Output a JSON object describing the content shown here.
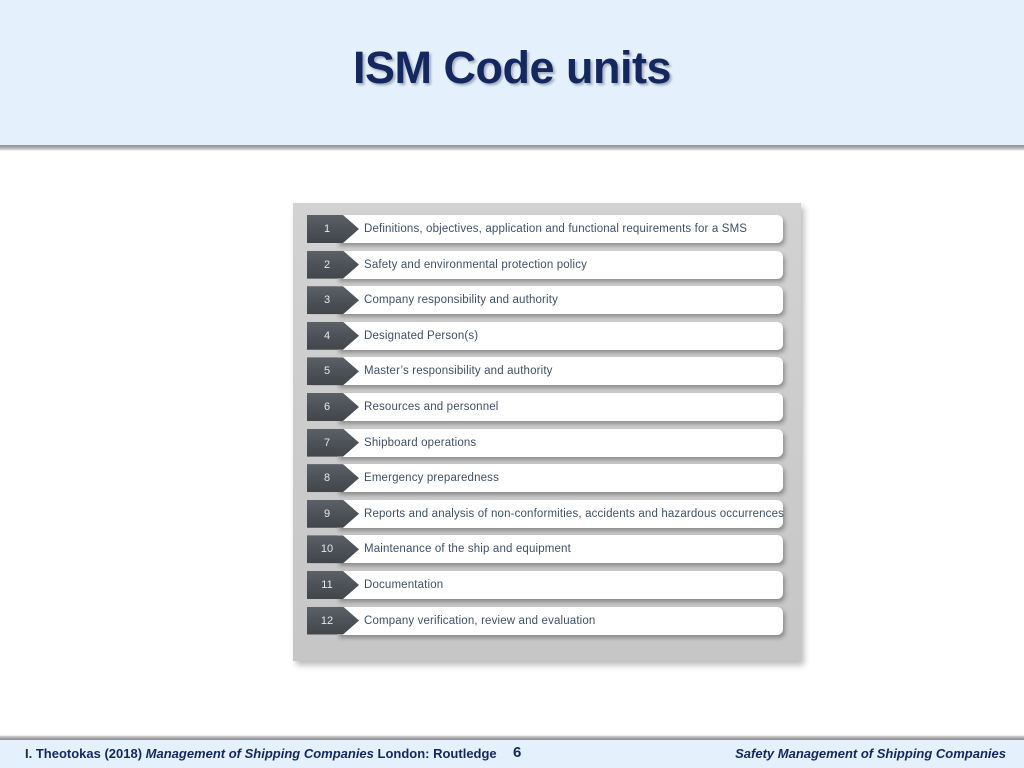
{
  "slide": {
    "title": "ISM Code units",
    "background_color": "#ffffff",
    "header_band_color": "#e4f0fc",
    "title_color": "#14285f"
  },
  "diagram": {
    "panel_color": "#cccccc",
    "chevron_color": "#4e5359",
    "bar_color": "#ffffff",
    "label_color": "#3f5166",
    "items": [
      {
        "number": "1",
        "label": "Definitions,  objectives,  application  and  functional  requirements  for a SMS"
      },
      {
        "number": "2",
        "label": "Safety  and environmental  protection  policy"
      },
      {
        "number": "3",
        "label": "Company  responsibility  and authority"
      },
      {
        "number": "4",
        "label": "Designated  Person(s)"
      },
      {
        "number": "5",
        "label": "Master’s responsibility  and  authority"
      },
      {
        "number": "6",
        "label": "Resources  and  personnel"
      },
      {
        "number": "7",
        "label": "Shipboard  operations"
      },
      {
        "number": "8",
        "label": "Emergency  preparedness"
      },
      {
        "number": "9",
        "label": "Reports  and analysis  of non-conformities,  accidents  and  hazardous  occurrences"
      },
      {
        "number": "10",
        "label": "Maintenance   of the ship and  equipment"
      },
      {
        "number": "11",
        "label": "Documentation"
      },
      {
        "number": "12",
        "label": "Company  verification,  review and  evaluation"
      }
    ]
  },
  "footer": {
    "citation_author": "I. Theotokas (2018) ",
    "citation_title": "Management of Shipping Companies",
    "citation_publisher": " London: Routledge",
    "page_number": "6",
    "right_label": "Safety Management of Shipping Companies"
  }
}
